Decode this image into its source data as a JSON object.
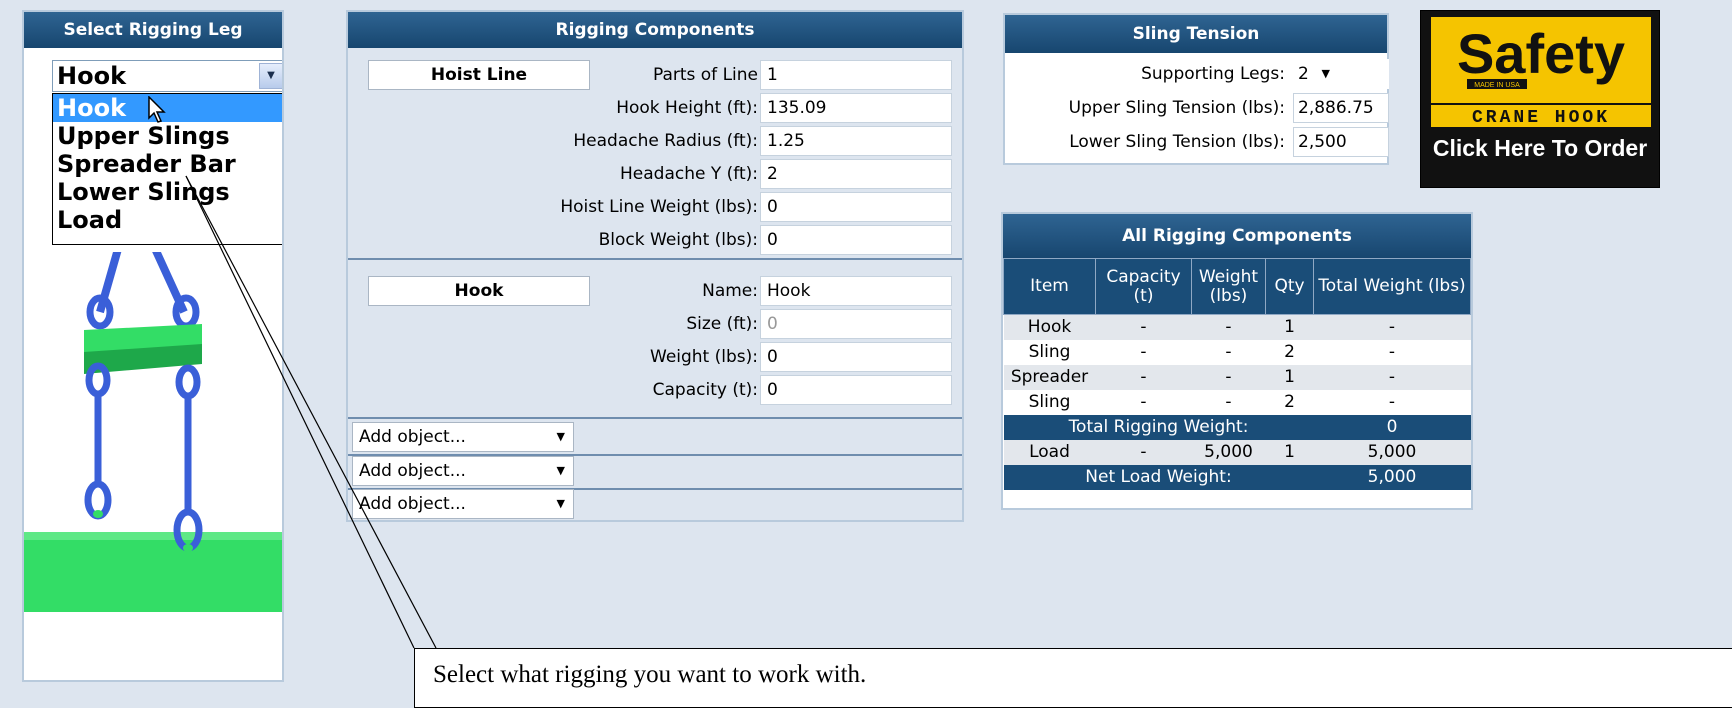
{
  "left_panel": {
    "title": "Select Rigging Leg",
    "selected": "Hook",
    "options": [
      "Hook",
      "Upper Slings",
      "Spreader Bar",
      "Lower Slings",
      "Load"
    ],
    "highlighted_index": 0
  },
  "rigging_components": {
    "title": "Rigging Components",
    "hoist_line": {
      "label": "Hoist Line",
      "fields": [
        {
          "label": "Parts of Line",
          "value": "1"
        },
        {
          "label": "Hook Height (ft):",
          "value": "135.09"
        },
        {
          "label": "Headache Radius (ft):",
          "value": "1.25"
        },
        {
          "label": "Headache Y (ft):",
          "value": "2"
        },
        {
          "label": "Hoist Line Weight (lbs):",
          "value": "0"
        },
        {
          "label": "Block Weight (lbs):",
          "value": "0"
        }
      ]
    },
    "hook": {
      "label": "Hook",
      "fields": [
        {
          "label": "Name:",
          "value": "Hook"
        },
        {
          "label": "Size (ft):",
          "value": "0"
        },
        {
          "label": "Weight (lbs):",
          "value": "0"
        },
        {
          "label": "Capacity (t):",
          "value": "0"
        }
      ]
    },
    "add_objects": [
      "Add object...",
      "Add object...",
      "Add object..."
    ]
  },
  "sling_tension": {
    "title": "Sling Tension",
    "supporting_legs_label": "Supporting Legs:",
    "supporting_legs": "2",
    "upper_label": "Upper Sling Tension (lbs):",
    "upper_value": "2,886.75",
    "lower_label": "Lower Sling Tension (lbs):",
    "lower_value": "2,500"
  },
  "ad": {
    "brand": "Safety J",
    "made_in": "MADE IN USA",
    "subtitle": "CRANE HOOK",
    "cta": "Click Here To Order"
  },
  "all_rigging": {
    "title": "All Rigging Components",
    "headers": [
      "Item",
      "Capacity (t)",
      "Weight (lbs)",
      "Qty",
      "Total Weight (lbs)"
    ],
    "rows": [
      [
        "Hook",
        "-",
        "-",
        "1",
        "-"
      ],
      [
        "Sling",
        "-",
        "-",
        "2",
        "-"
      ],
      [
        "Spreader",
        "-",
        "-",
        "1",
        "-"
      ],
      [
        "Sling",
        "-",
        "-",
        "2",
        "-"
      ]
    ],
    "total_rigging_label": "Total Rigging Weight:",
    "total_rigging_value": "0",
    "load_row": [
      "Load",
      "-",
      "5,000",
      "1",
      "5,000"
    ],
    "net_label": "Net Load Weight:",
    "net_value": "5,000"
  },
  "tooltip": {
    "text": "Select what rigging you want to work with."
  },
  "colors": {
    "header": "#1a4d78",
    "background": "#dde5ef",
    "selection": "#3399ff",
    "rig_green": "#33dd66",
    "rig_blue": "#3a5fd8",
    "ad_yellow": "#f5c400"
  }
}
